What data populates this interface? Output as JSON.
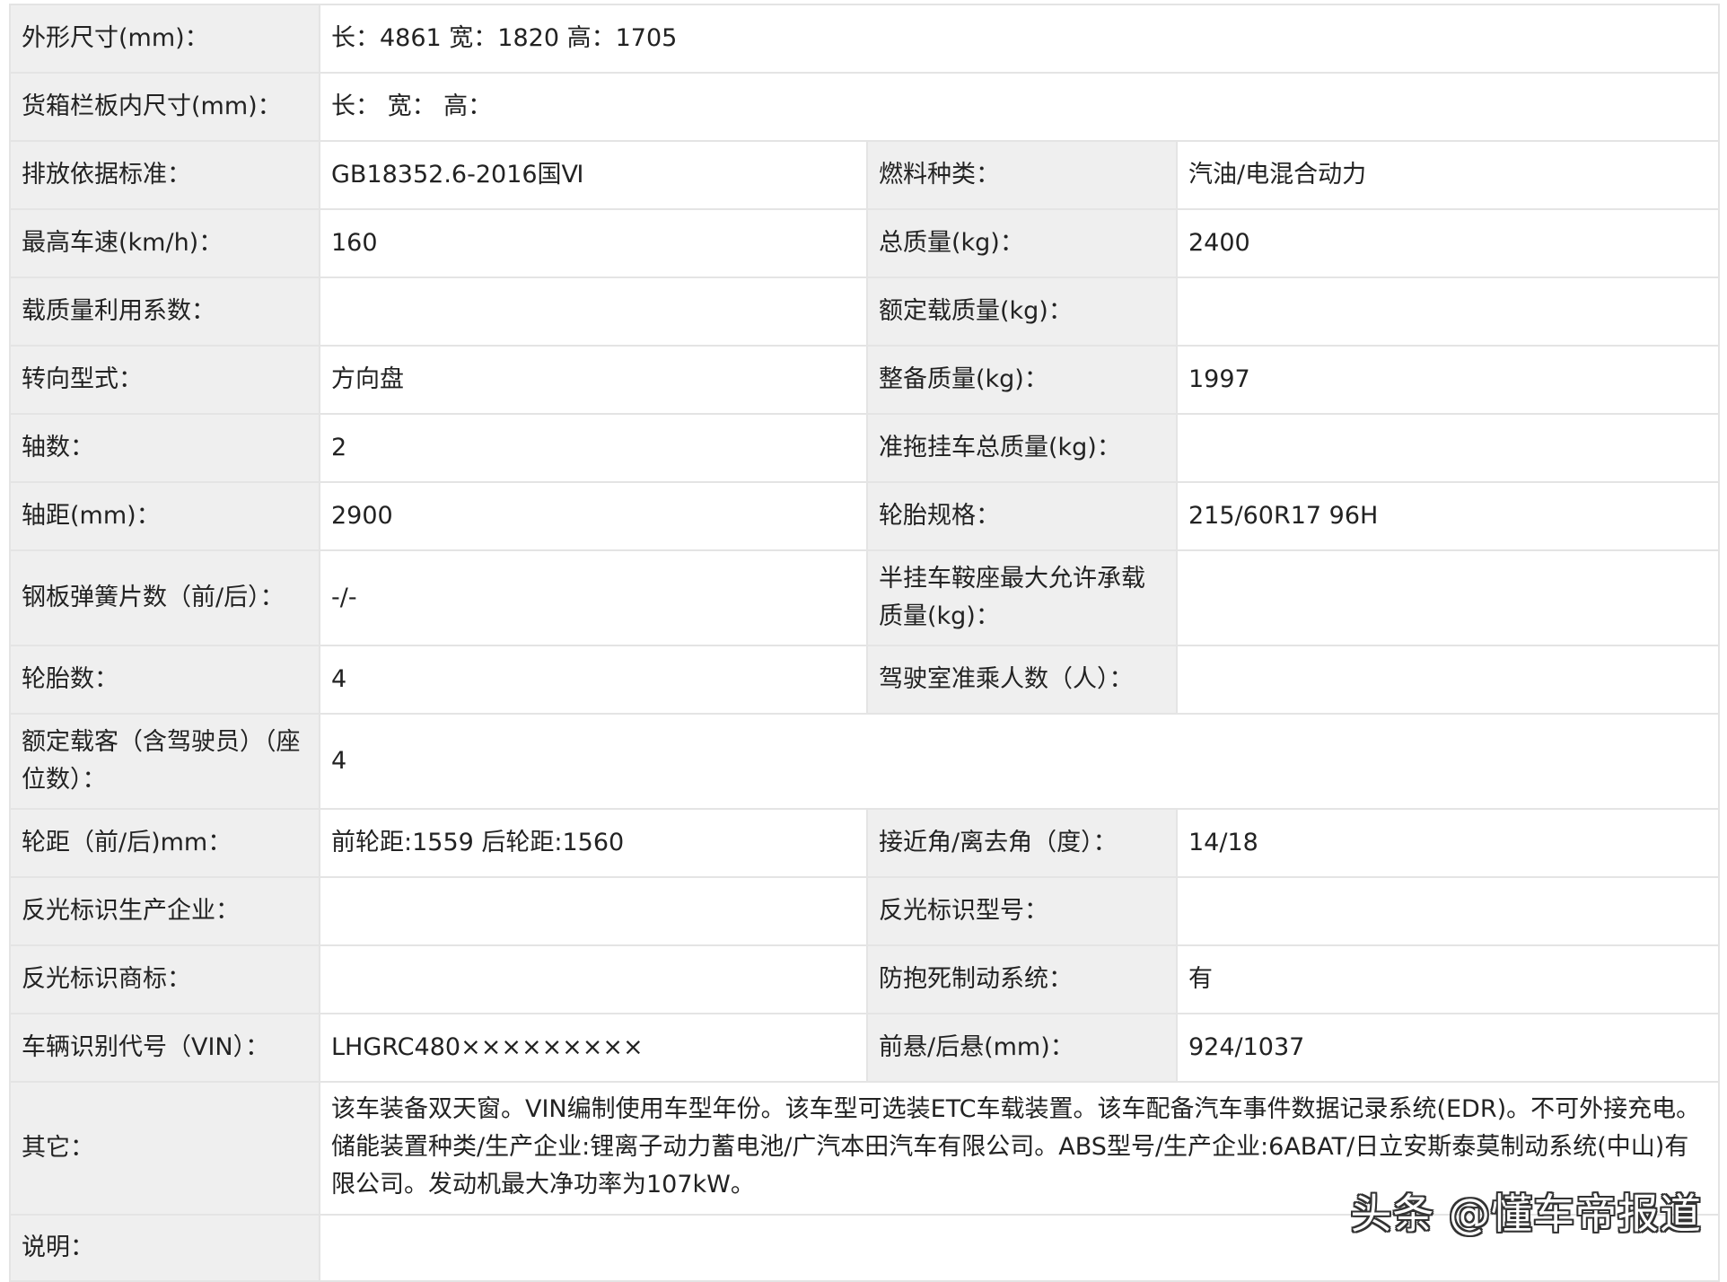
{
  "rows": [
    {
      "label": "外形尺寸(mm)：",
      "value": "长：4861 宽：1820 高：1705"
    },
    {
      "label": "货箱栏板内尺寸(mm)：",
      "value": "长：  宽：  高："
    },
    {
      "label": "排放依据标准：",
      "value": "GB18352.6-2016国Ⅵ",
      "label2": "燃料种类：",
      "value2": "汽油/电混合动力"
    },
    {
      "label": "最高车速(km/h)：",
      "value": "160",
      "label2": "总质量(kg)：",
      "value2": "2400"
    },
    {
      "label": "载质量利用系数：",
      "value": "",
      "label2": "额定载质量(kg)：",
      "value2": ""
    },
    {
      "label": "转向型式：",
      "value": "方向盘",
      "label2": "整备质量(kg)：",
      "value2": "1997"
    },
    {
      "label": "轴数：",
      "value": "2",
      "label2": "准拖挂车总质量(kg)：",
      "value2": ""
    },
    {
      "label": "轴距(mm)：",
      "value": "2900",
      "label2": "轮胎规格：",
      "value2": "215/60R17 96H"
    },
    {
      "label": "钢板弹簧片数（前/后）：",
      "value": "-/-",
      "label2": "半挂车鞍座最大允许承载质量(kg)：",
      "value2": ""
    },
    {
      "label": "轮胎数：",
      "value": "4",
      "label2": "驾驶室准乘人数（人）：",
      "value2": ""
    },
    {
      "label": "额定载客（含驾驶员）（座位数）：",
      "value": "4"
    },
    {
      "label": "轮距（前/后)mm：",
      "value": "前轮距:1559 后轮距:1560",
      "label2": "接近角/离去角（度）：",
      "value2": "14/18"
    },
    {
      "label": "反光标识生产企业：",
      "value": "",
      "label2": "反光标识型号：",
      "value2": ""
    },
    {
      "label": "反光标识商标：",
      "value": "",
      "label2": "防抱死制动系统：",
      "value2": "有"
    },
    {
      "label": "车辆识别代号（VIN）：",
      "value": "LHGRC480×××××××××",
      "label2": "前悬/后悬(mm)：",
      "value2": "924/1037"
    },
    {
      "label": "其它：",
      "value": "该车装备双天窗。VIN编制使用车型年份。该车型可选装ETC车载装置。该车配备汽车事件数据记录系统(EDR)。不可外接充电。储能装置种类/生产企业:锂离子动力蓄电池/广汽本田汽车有限公司。ABS型号/生产企业:6ABAT/日立安斯泰莫制动系统(中山)有限公司。发动机最大净功率为107kW。"
    },
    {
      "label": "说明：",
      "value": ""
    }
  ],
  "watermark": "头条 @懂车帝报道"
}
